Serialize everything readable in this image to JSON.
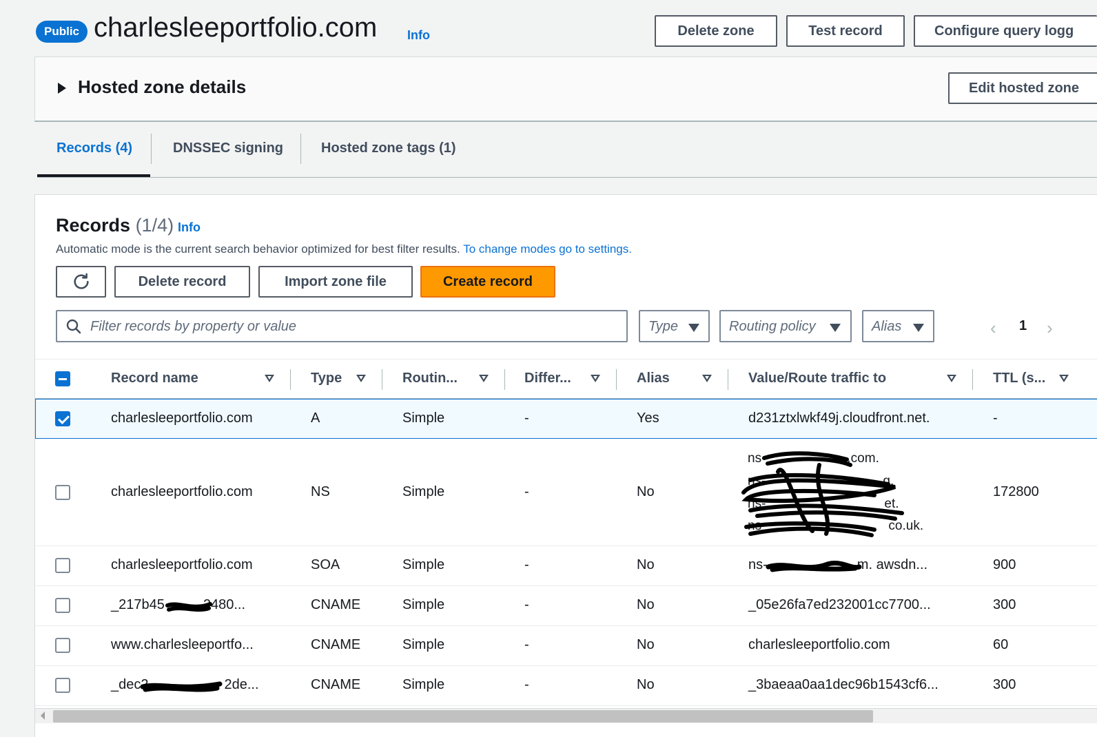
{
  "header": {
    "badge": "Public",
    "title": "charlesleeportfolio.com",
    "info": "Info",
    "buttons": {
      "delete_zone": "Delete zone",
      "test_record": "Test record",
      "configure_query_logging": "Configure query logg"
    }
  },
  "details": {
    "title": "Hosted zone details",
    "edit_button": "Edit hosted zone"
  },
  "tabs": [
    {
      "label": "Records (4)",
      "active": true
    },
    {
      "label": "DNSSEC signing",
      "active": false
    },
    {
      "label": "Hosted zone tags (1)",
      "active": false
    }
  ],
  "records_panel": {
    "title": "Records",
    "count": "(1/4)",
    "info": "Info",
    "description": "Automatic mode is the current search behavior optimized for best filter results.",
    "settings_link": "To change modes go to settings.",
    "buttons": {
      "delete_record": "Delete record",
      "import_zone_file": "Import zone file",
      "create_record": "Create record"
    },
    "search_placeholder": "Filter records by property or value",
    "filters": {
      "type": "Type",
      "routing_policy": "Routing policy",
      "alias": "Alias"
    },
    "pagination": {
      "prev": "‹",
      "page": "1",
      "next": "›"
    }
  },
  "table": {
    "columns": {
      "record_name": "Record name",
      "type": "Type",
      "routing": "Routin...",
      "differ": "Differ...",
      "alias": "Alias",
      "value": "Value/Route traffic to",
      "ttl": "TTL (s..."
    },
    "rows": [
      {
        "name": "charlesleeportfolio.com",
        "type": "A",
        "routing": "Simple",
        "differ": "-",
        "alias": "Yes",
        "value": "d231ztxlwkf49j.cloudfront.net.",
        "ttl": "-",
        "selected": true
      },
      {
        "name": "charlesleeportfolio.com",
        "type": "NS",
        "routing": "Simple",
        "differ": "-",
        "alias": "No",
        "value_lines": [
          "ns-",
          "ns-",
          "ns-",
          "ns-"
        ],
        "value_line_suffixes": [
          ".com.",
          "g.",
          "et.",
          "co.uk."
        ],
        "ttl": "172800",
        "selected": false
      },
      {
        "name": "charlesleeportfolio.com",
        "type": "SOA",
        "routing": "Simple",
        "differ": "-",
        "alias": "No",
        "value_prefix": "ns-",
        "value_suffix": "m. awsdn...",
        "ttl": "900",
        "selected": false
      },
      {
        "name_prefix": "_217b45",
        "name_suffix": "2480...",
        "type": "CNAME",
        "routing": "Simple",
        "differ": "-",
        "alias": "No",
        "value": "_05e26fa7ed232001cc7700...",
        "ttl": "300",
        "selected": false
      },
      {
        "name": "www.charlesleeportfo...",
        "type": "CNAME",
        "routing": "Simple",
        "differ": "-",
        "alias": "No",
        "value": "charlesleeportfolio.com",
        "ttl": "60",
        "selected": false
      },
      {
        "name_prefix": "_dec2",
        "name_suffix": "2de...",
        "type": "CNAME",
        "routing": "Simple",
        "differ": "-",
        "alias": "No",
        "value": "_3baeaa0aa1dec96b1543cf6...",
        "ttl": "300",
        "selected": false
      }
    ]
  },
  "icons": {
    "refresh": "refresh-icon",
    "search": "search-icon",
    "caret": "caret-right-icon"
  },
  "colors": {
    "primary": "#0972d3",
    "accent": "#ff9900"
  }
}
